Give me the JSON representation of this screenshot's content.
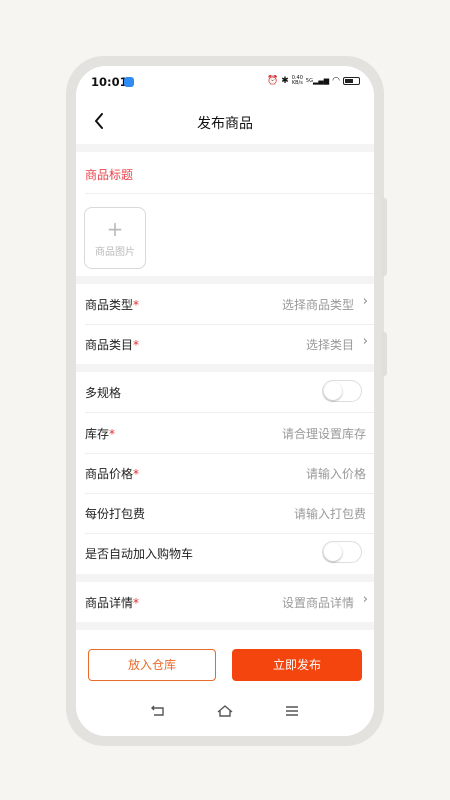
{
  "statusbar": {
    "time": "10:01",
    "net_speed_value": "0.40",
    "net_speed_unit": "KB/s",
    "signal": "5G"
  },
  "header": {
    "back_icon": "chevron-left-icon",
    "title": "发布商品"
  },
  "form": {
    "title_label": "商品标题",
    "image_upload": {
      "plus": "+",
      "label": "商品图片"
    },
    "type": {
      "label": "商品类型",
      "required_mark": "*",
      "placeholder": "选择商品类型"
    },
    "category": {
      "label": "商品类目",
      "required_mark": "*",
      "placeholder": "选择类目"
    },
    "multi_spec": {
      "label": "多规格",
      "enabled": false
    },
    "stock": {
      "label": "库存",
      "required_mark": "*",
      "placeholder": "请合理设置库存"
    },
    "price": {
      "label": "商品价格",
      "required_mark": "*",
      "placeholder": "请输入价格"
    },
    "packing_fee": {
      "label": "每份打包费",
      "placeholder": "请输入打包费"
    },
    "auto_cart": {
      "label": "是否自动加入购物车",
      "enabled": false
    },
    "detail": {
      "label": "商品详情",
      "required_mark": "*",
      "placeholder": "设置商品详情"
    }
  },
  "actions": {
    "store_label": "放入仓库",
    "publish_label": "立即发布"
  },
  "colors": {
    "accent": "#f5450f",
    "required": "#e02e2e",
    "title_red": "#e8454a"
  }
}
